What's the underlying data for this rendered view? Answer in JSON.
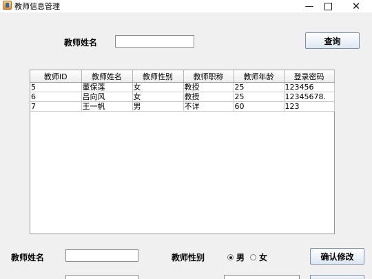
{
  "window": {
    "title": "教师信息管理",
    "minimize": "—",
    "close": "✕"
  },
  "search": {
    "name_label": "教师姓名",
    "name_value": "",
    "query_button": "查询"
  },
  "table": {
    "headers": [
      "教师ID",
      "教师姓名",
      "教师性别",
      "教师职称",
      "教师年龄",
      "登录密码"
    ],
    "rows": [
      [
        "5",
        "董保莲",
        "女",
        "教授",
        "25",
        "123456"
      ],
      [
        "6",
        "吕向风",
        "女",
        "教授",
        "25",
        "12345678."
      ],
      [
        "7",
        "王一帆",
        "男",
        "不详",
        "60",
        "123"
      ]
    ]
  },
  "edit": {
    "name_label": "教师姓名",
    "name_value": "",
    "gender_label": "教师性别",
    "gender_options": [
      "男",
      "女"
    ],
    "gender_selected": "男",
    "confirm_button": "确认修改"
  }
}
